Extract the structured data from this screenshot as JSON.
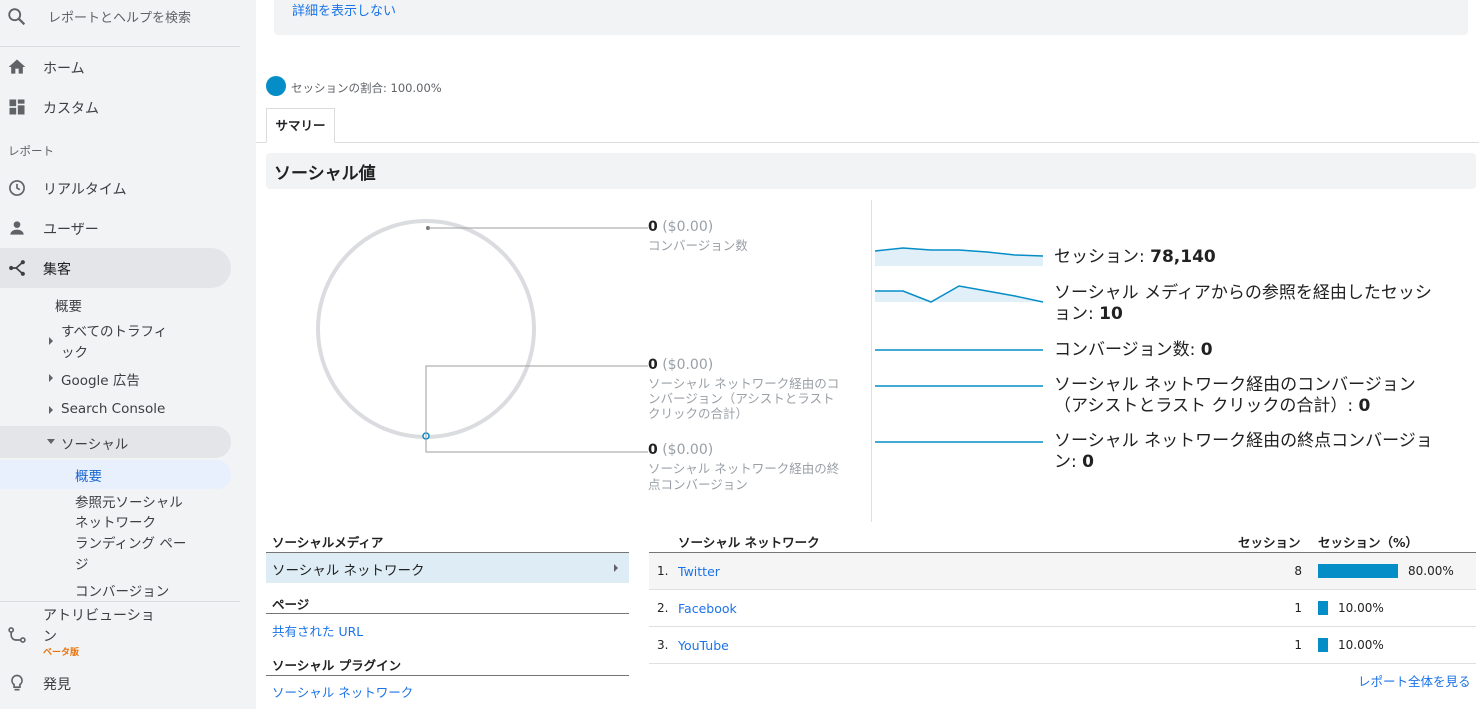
{
  "sidebar": {
    "search_placeholder": "レポートとヘルプを検索",
    "home": "ホーム",
    "custom": "カスタム",
    "reports_heading": "レポート",
    "realtime": "リアルタイム",
    "users": "ユーザー",
    "acquisition": "集客",
    "sub": {
      "overview": "概要",
      "all_traffic_1": "すべてのトラフィ",
      "all_traffic_2": "ック",
      "google_ads": "Google 広告",
      "search_console": "Search Console",
      "social": "ソーシャル",
      "social_overview": "概要",
      "ref_1": "参照元ソーシャル",
      "ref_2": "ネットワーク",
      "landing_1": "ランディング ペー",
      "landing_2": "ジ",
      "conversions": "コンバージョン"
    },
    "attribution_1": "アトリビューショ",
    "attribution_2": "ン",
    "beta": "ベータ版",
    "discover": "発見"
  },
  "top": {
    "hide_details": "詳細を表示しない",
    "segment": "セッションの割合: 100.00%",
    "tab_summary": "サマリー"
  },
  "social_value": {
    "title": "ソーシャル値",
    "conv1_value": "0",
    "conv1_money": "($0.00)",
    "conv1_label": "コンバージョン数",
    "conv2_value": "0",
    "conv2_money": "($0.00)",
    "conv2_label_1": "ソーシャル ネットワーク経由のコ",
    "conv2_label_2": "ンバージョン（アシストとラスト",
    "conv2_label_3": "クリックの合計）",
    "conv3_value": "0",
    "conv3_money": "($0.00)",
    "conv3_label_1": "ソーシャル ネットワーク経由の終",
    "conv3_label_2": "点コンバージョン"
  },
  "metrics": {
    "m1_label": "セッション: ",
    "m1_value": "78,140",
    "m2_label_1": "ソーシャル メディアからの参照を経由したセッシ",
    "m2_label_2": "ョン: ",
    "m2_value": "10",
    "m3_label": "コンバージョン数: ",
    "m3_value": "0",
    "m4_label_1": "ソーシャル ネットワーク経由のコンバージョン",
    "m4_label_2": "（アシストとラスト クリックの合計）: ",
    "m4_value": "0",
    "m5_label_1": "ソーシャル ネットワーク経由の終点コンバージョ",
    "m5_label_2": "ン: ",
    "m5_value": "0"
  },
  "left_table": {
    "social_media": "ソーシャルメディア",
    "social_network": "ソーシャル ネットワーク",
    "page": "ページ",
    "shared_url": "共有された URL",
    "social_plugin": "ソーシャル プラグイン",
    "plugin_network": "ソーシャル ネットワーク"
  },
  "right_table": {
    "col_network": "ソーシャル ネットワーク",
    "col_sessions": "セッション",
    "col_pct": "セッション（%）",
    "rows": [
      {
        "num": "1.",
        "network": "Twitter",
        "sessions": "8",
        "pct": "80.00%",
        "share": 0.8
      },
      {
        "num": "2.",
        "network": "Facebook",
        "sessions": "1",
        "pct": "10.00%",
        "share": 0.1
      },
      {
        "num": "3.",
        "network": "YouTube",
        "sessions": "1",
        "pct": "10.00%",
        "share": 0.1
      }
    ],
    "full_report": "レポート全体を見る"
  },
  "colors": {
    "accent": "#058dc7",
    "link": "#1a73e8",
    "sidebar_bg": "#f1f3f4"
  }
}
